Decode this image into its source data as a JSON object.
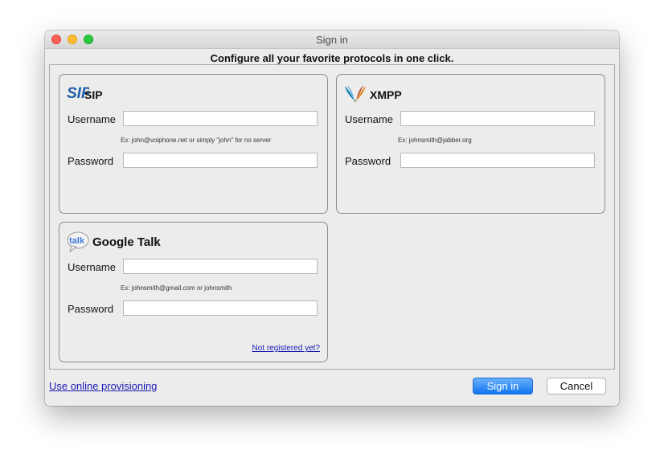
{
  "window": {
    "title": "Sign in"
  },
  "header": {
    "text": "Configure all your favorite protocols in one click."
  },
  "sip": {
    "logo_text": "SIP",
    "title": "SIP",
    "username_label": "Username",
    "username_value": "",
    "hint": "Ex: john@voiphone.net or simply \"john\" for no server",
    "password_label": "Password",
    "password_value": ""
  },
  "xmpp": {
    "title": "XMPP",
    "username_label": "Username",
    "username_value": "",
    "hint": "Ex: johnsmith@jabber.org",
    "password_label": "Password",
    "password_value": ""
  },
  "gtalk": {
    "logo_text": "talk",
    "title": "Google Talk",
    "username_label": "Username",
    "username_value": "",
    "hint": "Ex: johnsmith@gmail.com or johnsmith",
    "password_label": "Password",
    "password_value": "",
    "register_link": "Not registered yet?"
  },
  "footer": {
    "provisioning_link": "Use online provisioning",
    "signin_label": "Sign in",
    "cancel_label": "Cancel"
  },
  "colors": {
    "link": "#1a1ab4",
    "primary_button": "#1275f2",
    "sip_logo": "#1f5fa8"
  },
  "icons": {
    "sip": "sip-logo-icon",
    "xmpp": "xmpp-logo-icon",
    "gtalk": "google-talk-logo-icon"
  }
}
